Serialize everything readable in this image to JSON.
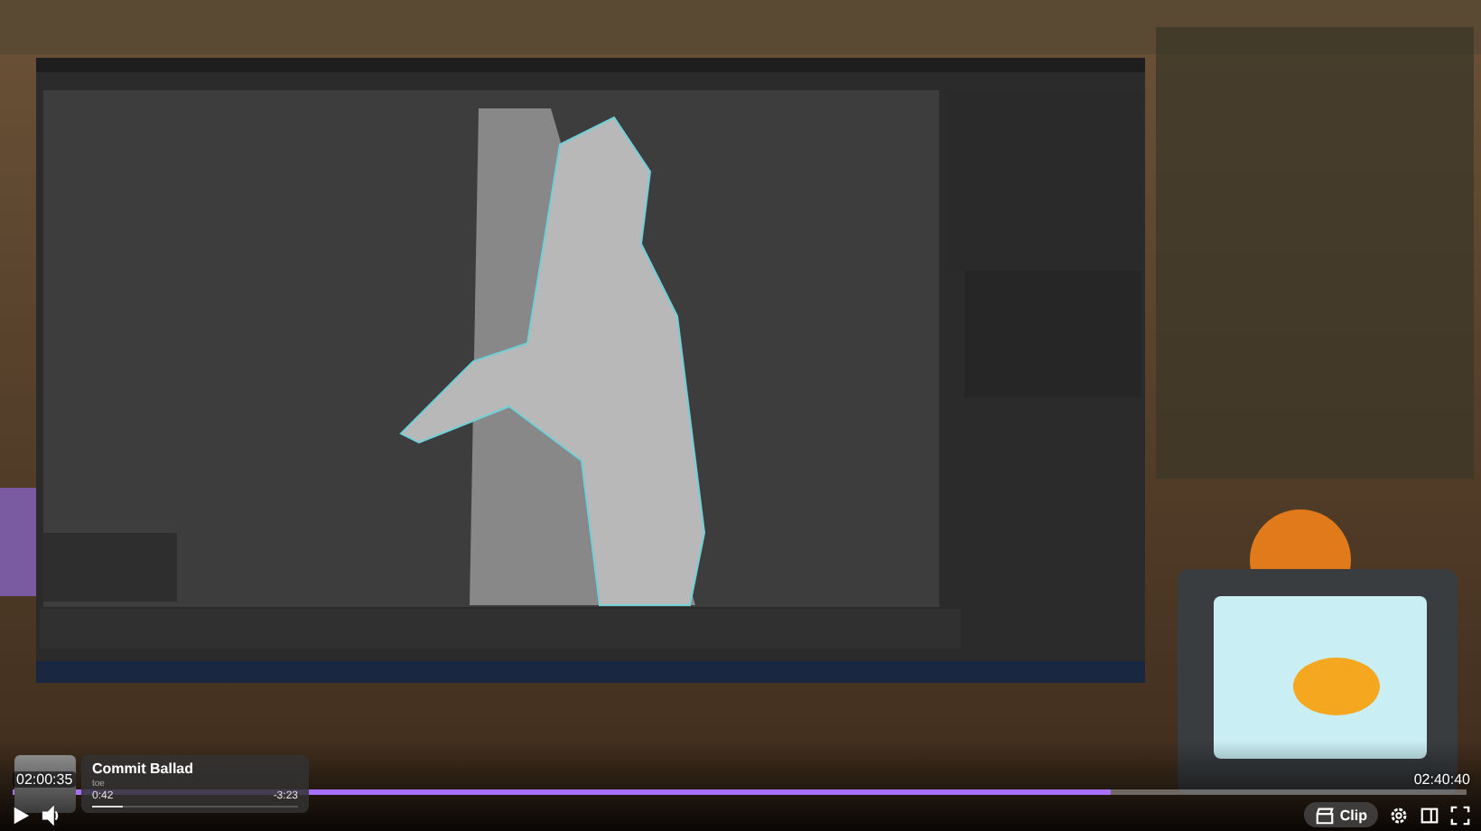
{
  "player": {
    "elapsed": "02:00:35",
    "duration": "02:40:40",
    "progress": {
      "level": 0.755
    },
    "playing": false,
    "now_playing": {
      "title": "Commit Ballad",
      "artist": "toe",
      "position": "0:42",
      "remaining": "-3:23",
      "level": 0.15
    },
    "clip_button": {
      "label": "Clip"
    }
  }
}
